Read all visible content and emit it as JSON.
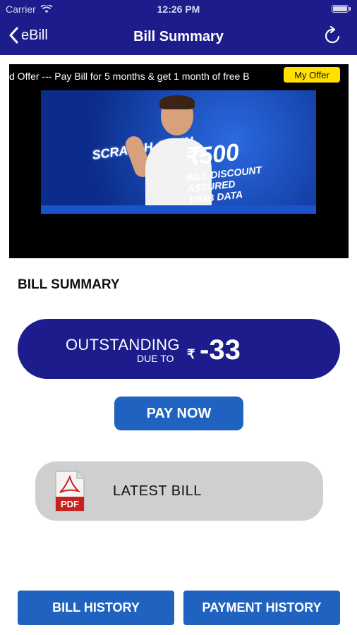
{
  "status_bar": {
    "carrier": "Carrier",
    "time": "12:26 PM"
  },
  "nav": {
    "back_label": "eBill",
    "title": "Bill Summary"
  },
  "banner": {
    "ticker_text": "d Offer --- Pay Bill for 5 months & get 1 month of free B",
    "my_offer_label": "My Offer",
    "promo_scratch": "SCRATCH & WIN",
    "promo_currency": "₹",
    "promo_amount": "500",
    "promo_line1": "BILL DISCOUNT",
    "promo_line2": "ASSURED",
    "promo_line3": "10GB DATA"
  },
  "summary": {
    "section_title": "BILL SUMMARY",
    "outstanding_label": "OUTSTANDING",
    "due_to_label": "DUE TO",
    "currency_symbol": "₹",
    "amount": "-33"
  },
  "actions": {
    "pay_now_label": "PAY NOW",
    "latest_bill_label": "LATEST BILL",
    "pdf_label": "PDF",
    "bill_history_label": "BILL HISTORY",
    "payment_history_label": "PAYMENT HISTORY"
  },
  "colors": {
    "header_bg": "#1c1c8c",
    "outstanding_bg": "#1c1c8c",
    "button_blue": "#1f62c0",
    "offer_yellow": "#ffe000",
    "latest_bill_bg": "#cfcfcf",
    "pdf_red": "#c8201c"
  },
  "icons": [
    "wifi-icon",
    "battery-icon",
    "back-chevron-icon",
    "refresh-icon",
    "pdf-icon"
  ]
}
